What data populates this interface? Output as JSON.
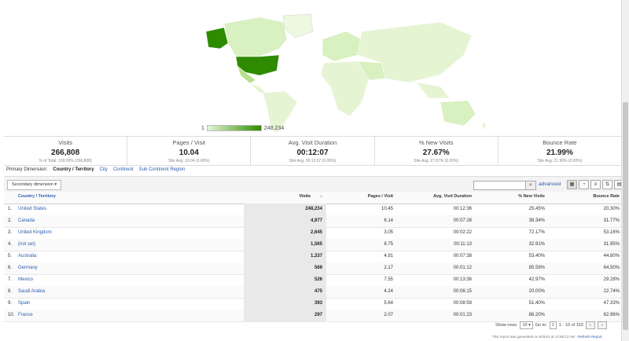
{
  "colors": {
    "map_high": "#2e8b00",
    "map_low": "#e5f5d4",
    "link": "#2a5db0"
  },
  "map": {
    "legend_min": "1",
    "legend_max": "248,234"
  },
  "scorecard": [
    {
      "label": "Visits",
      "value": "266,808",
      "sub": "% of Total: 100.00% (266,808)"
    },
    {
      "label": "Pages / Visit",
      "value": "10.04",
      "sub": "Site Avg: 10.04 (0.00%)"
    },
    {
      "label": "Avg. Visit Duration",
      "value": "00:12:07",
      "sub": "Site Avg: 00:12:07 (0.00%)"
    },
    {
      "label": "% New Visits",
      "value": "27.67%",
      "sub": "Site Avg: 27.67% (0.00%)"
    },
    {
      "label": "Bounce Rate",
      "value": "21.99%",
      "sub": "Site Avg: 21.99% (0.00%)"
    }
  ],
  "dimensions": {
    "prefix": "Primary Dimension:",
    "current": "Country / Territory",
    "options": [
      "City",
      "Continent",
      "Sub Continent Region"
    ]
  },
  "toolbar": {
    "secondary": "Secondary dimension ▾",
    "search_icon": "magnifier-icon",
    "advanced": "advanced"
  },
  "columns": {
    "name": "Country / Territory",
    "visits": "Visits",
    "sort": "↓",
    "pv": "Pages / Visit",
    "dur": "Avg. Visit Duration",
    "new": "% New Visits",
    "bounce": "Bounce Rate"
  },
  "rows": [
    {
      "n": "1.",
      "name": "United States",
      "visits": "248,234",
      "pv": "10.45",
      "dur": "00:12:36",
      "new": "25.45%",
      "bounce": "20.30%"
    },
    {
      "n": "2.",
      "name": "Canada",
      "visits": "4,977",
      "pv": "6.14",
      "dur": "00:07:28",
      "new": "38.34%",
      "bounce": "31.77%"
    },
    {
      "n": "3.",
      "name": "United Kingdom",
      "visits": "2,645",
      "pv": "3.05",
      "dur": "00:02:22",
      "new": "72.17%",
      "bounce": "53.16%"
    },
    {
      "n": "4.",
      "name": "(not set)",
      "visits": "1,565",
      "pv": "8.75",
      "dur": "00:11:13",
      "new": "32.91%",
      "bounce": "31.95%"
    },
    {
      "n": "5.",
      "name": "Australia",
      "visits": "1,337",
      "pv": "4.91",
      "dur": "00:07:38",
      "new": "53.40%",
      "bounce": "44.80%"
    },
    {
      "n": "6.",
      "name": "Germany",
      "visits": "569",
      "pv": "2.17",
      "dur": "00:01:12",
      "new": "85.59%",
      "bounce": "64.50%"
    },
    {
      "n": "7.",
      "name": "Mexico",
      "visits": "526",
      "pv": "7.55",
      "dur": "00:13:36",
      "new": "42.97%",
      "bounce": "29.28%"
    },
    {
      "n": "8.",
      "name": "Saudi Arabia",
      "visits": "475",
      "pv": "4.24",
      "dur": "00:06:15",
      "new": "20.00%",
      "bounce": "22.74%"
    },
    {
      "n": "9.",
      "name": "Spain",
      "visits": "393",
      "pv": "5.64",
      "dur": "00:08:59",
      "new": "51.40%",
      "bounce": "47.33%"
    },
    {
      "n": "10.",
      "name": "France",
      "visits": "297",
      "pv": "2.07",
      "dur": "00:01:23",
      "new": "86.20%",
      "bounce": "62.96%"
    }
  ],
  "pager": {
    "show_rows": "Show rows:",
    "rows_value": "10 ▾",
    "goto": "Go to:",
    "goto_value": "1",
    "range": "1 - 10 of 153",
    "prev": "‹",
    "next": "›"
  },
  "footer": {
    "text": "This report was generated on 9/2012 at 12:58:13 AM - ",
    "refresh": "Refresh Report"
  }
}
